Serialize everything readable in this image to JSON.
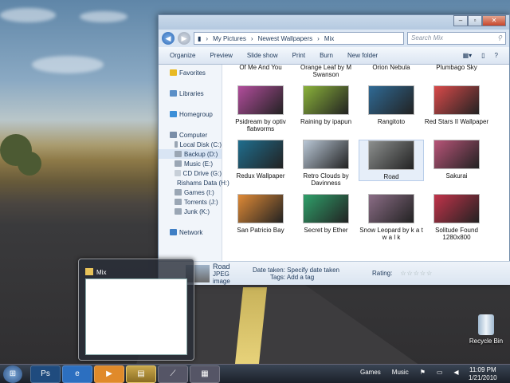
{
  "explorer": {
    "breadcrumb": [
      "My Pictures",
      "Newest Wallpapers",
      "Mix"
    ],
    "search_placeholder": "Search Mix",
    "toolbar": [
      "Organize",
      "Preview",
      "Slide show",
      "Print",
      "Burn",
      "New folder"
    ],
    "nav": [
      {
        "label": "Favorites",
        "icon": "star-icon",
        "indent": 0,
        "gap": false,
        "sel": false
      },
      {
        "label": "Libraries",
        "icon": "library-icon",
        "indent": 0,
        "gap": true,
        "sel": false
      },
      {
        "label": "Homegroup",
        "icon": "homegroup-icon",
        "indent": 0,
        "gap": true,
        "sel": false
      },
      {
        "label": "Computer",
        "icon": "computer-icon",
        "indent": 0,
        "gap": true,
        "sel": false
      },
      {
        "label": "Local Disk (C:)",
        "icon": "drive-icon",
        "indent": 1,
        "gap": false,
        "sel": false
      },
      {
        "label": "Backup (D:)",
        "icon": "drive-icon",
        "indent": 1,
        "gap": false,
        "sel": true
      },
      {
        "label": "Music (E:)",
        "icon": "drive-icon",
        "indent": 1,
        "gap": false,
        "sel": false
      },
      {
        "label": "CD Drive (G:)",
        "icon": "cd-icon",
        "indent": 1,
        "gap": false,
        "sel": false
      },
      {
        "label": "Rishams Data (H:)",
        "icon": "drive-icon",
        "indent": 1,
        "gap": false,
        "sel": false
      },
      {
        "label": "Games (I:)",
        "icon": "drive-icon",
        "indent": 1,
        "gap": false,
        "sel": false
      },
      {
        "label": "Torrents (J:)",
        "icon": "drive-icon",
        "indent": 1,
        "gap": false,
        "sel": false
      },
      {
        "label": "Junk (K:)",
        "icon": "drive-icon",
        "indent": 1,
        "gap": false,
        "sel": false
      },
      {
        "label": "Network",
        "icon": "network-icon",
        "indent": 0,
        "gap": true,
        "sel": false
      }
    ],
    "files": [
      {
        "name": "Of Me And You",
        "color": "#c9c0b0"
      },
      {
        "name": "Orange Leaf by M Swanson",
        "color": "#d98a2a"
      },
      {
        "name": "Orion Nebula",
        "color": "#4d4a7a"
      },
      {
        "name": "Plumbago Sky",
        "color": "#7f9bc6"
      },
      {
        "name": "Psidream by optiv flatworms",
        "color": "#b24d9c"
      },
      {
        "name": "Raining by ipapun",
        "color": "#8ab23a"
      },
      {
        "name": "Rangitoto",
        "color": "#2f6a95"
      },
      {
        "name": "Red Stars II Wallpaper",
        "color": "#d94a4a"
      },
      {
        "name": "Redux Wallpaper",
        "color": "#1f6e8e"
      },
      {
        "name": "Retro Clouds by Davinness",
        "color": "#b9c7d6"
      },
      {
        "name": "Road",
        "color": "#8c8f8e"
      },
      {
        "name": "Sakurai",
        "color": "#b85478"
      },
      {
        "name": "San Patricio Bay",
        "color": "#e08a36"
      },
      {
        "name": "Secret by Ether",
        "color": "#2fa06a"
      },
      {
        "name": "Snow Leopard by k a t w a l k",
        "color": "#8b6d86"
      },
      {
        "name": "Solitude Found 1280x800",
        "color": "#c2334a"
      }
    ],
    "details": {
      "name": "Road",
      "type": "JPEG image",
      "date_label": "Date taken:",
      "date_value": "Specify date taken",
      "tags_label": "Tags:",
      "tags_value": "Add a tag",
      "rating_label": "Rating:",
      "rating_stars": "☆☆☆☆☆"
    }
  },
  "preview": {
    "title": "Mix"
  },
  "desktop": {
    "recycle_label": "Recycle Bin"
  },
  "taskbar": {
    "apps": [
      {
        "label": "Ps",
        "name": "photoshop-button",
        "color": "#1f4b7e",
        "on": false
      },
      {
        "label": "e",
        "name": "ie-button",
        "color": "#2c6fc0",
        "on": false
      },
      {
        "label": "▶",
        "name": "media-player-button",
        "color": "#e08a2a",
        "on": false
      },
      {
        "label": "▤",
        "name": "explorer-button",
        "color": "#c9a74b",
        "on": true
      },
      {
        "label": "⟋",
        "name": "pen-app-button",
        "color": "#556",
        "on": false
      },
      {
        "label": "▦",
        "name": "calculator-button",
        "color": "#556",
        "on": false
      }
    ],
    "tray": [
      "Games",
      "Music"
    ],
    "time": "11:09 PM",
    "date": "1/21/2010"
  }
}
